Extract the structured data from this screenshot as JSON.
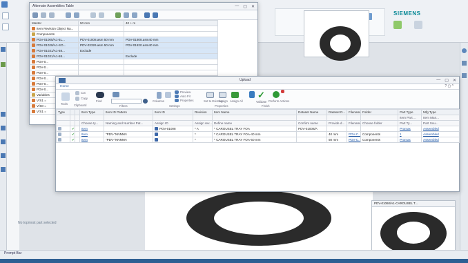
{
  "nx": {
    "brand": "SIEMENS",
    "bottom_hint": "No topmost part selected",
    "bottom_tab": "Prompt Bar",
    "search_placeholder": "",
    "viewport_caption": "PDV-01060/A1-CAROUSEL T..."
  },
  "alt_window": {
    "title": "Alternate Assemblies Table",
    "columns": [
      "Master",
      "50 mm",
      "40 + m"
    ],
    "rows": [
      {
        "name": "Item Revision Object Na...",
        "c1": "",
        "c2": ""
      },
      {
        "name": "Components",
        "c1": "",
        "c2": ""
      },
      {
        "name": "PDV-01005/A1-5L...",
        "c1": "PDV-01008.asm 50 mm",
        "c2": "PDV-01808.asm40 mm"
      },
      {
        "name": "PDV-01029/A1-SO...",
        "c1": "PDV-03326.asm 50 mm",
        "c2": "PDV-01820.asm40 mm"
      },
      {
        "name": "PDV-01031/A1-58...",
        "c1": "Exclude",
        "c2": ""
      },
      {
        "name": "PDV-01031/A1-58...",
        "c1": "",
        "c2": "Exclude"
      },
      {
        "name": "PDV-0...",
        "c1": "",
        "c2": ""
      },
      {
        "name": "PDV-0...",
        "c1": "",
        "c2": ""
      },
      {
        "name": "PDV-0...",
        "c1": "",
        "c2": ""
      },
      {
        "name": "PDV-0...",
        "c1": "",
        "c2": ""
      },
      {
        "name": "PDV-0...",
        "c1": "",
        "c2": ""
      },
      {
        "name": "PDV-0...",
        "c1": "",
        "c2": ""
      },
      {
        "name": "Variables",
        "c1": "",
        "c2": ""
      },
      {
        "name": "V/S1 =",
        "c1": "",
        "c2": ""
      },
      {
        "name": "V/S0 =",
        "c1": "",
        "c2": ""
      },
      {
        "name": "V/S1 =",
        "c1": "",
        "c2": ""
      }
    ]
  },
  "upload": {
    "title": "Upload",
    "tab": "Home",
    "ribbon": {
      "tools": "Tools",
      "cut": "Cut",
      "copy": "Copy",
      "paste": "Paste",
      "clipboard": "Clipboard",
      "find": "Find",
      "filters": "Filters",
      "columns": "Columns",
      "preview": "Preview",
      "auto_fit": "Auto Fit",
      "properties": "Properties",
      "settings": "Settings",
      "set_to_existing": "Set to Existing",
      "assign": "Assign",
      "assign_all": "Assign All",
      "properties_grp": "Properties",
      "validate": "Validate",
      "perform_actions": "Perform Actions",
      "finish": "Finish"
    },
    "columns": [
      "Type",
      "",
      "",
      "Item Type",
      "Item ID Pattern",
      "Item ID",
      "Revision",
      "Item Name",
      "Dataset Name",
      "Dataset D...",
      "Filename",
      "Folder",
      "Part Type",
      "Mfg Type"
    ],
    "subheader": [
      "",
      "",
      "",
      "Choose ty...",
      "Naming and Number Pat...",
      "Assign ID",
      "Assign rev...",
      "Define name",
      "Confirm name",
      "Provide d...",
      "Filename",
      "Choose folder",
      "Part Ty...",
      "Part Sou..."
    ],
    "subheader2": [
      "",
      "",
      "",
      "",
      "",
      "",
      "",
      "",
      "",
      "",
      "",
      "",
      "Item Part ...",
      "Item Man..."
    ],
    "rows": [
      {
        "item_type": "Item",
        "pattern": "",
        "item_id": "PDV-01008",
        "revision": "A",
        "name": "CAROUSEL TRAY FOA",
        "dataset": "PDV-01008/A",
        "dataset_d": "",
        "filename": "",
        "folder": "",
        "part_type": "Promax",
        "mfg_type": "Assembled"
      },
      {
        "item_type": "Item",
        "pattern": "\"PDV-\"NNNNN",
        "item_id": "",
        "revision": "",
        "name": "CAROUSEL TRAY FOA-40 mm",
        "dataset": "",
        "dataset_d": "40 mm",
        "filename": "PDV-C...",
        "folder": "Components",
        "part_type": "1",
        "mfg_type": "Assembled"
      },
      {
        "item_type": "Item",
        "pattern": "\"PDV-\"NNNNN",
        "item_id": "",
        "revision": "",
        "name": "CAROUSEL TRAY FOA-50 mm",
        "dataset": "",
        "dataset_d": "50 mm",
        "filename": "PDV-C...",
        "folder": "Components",
        "part_type": "Promax",
        "mfg_type": "Assembled"
      }
    ]
  }
}
